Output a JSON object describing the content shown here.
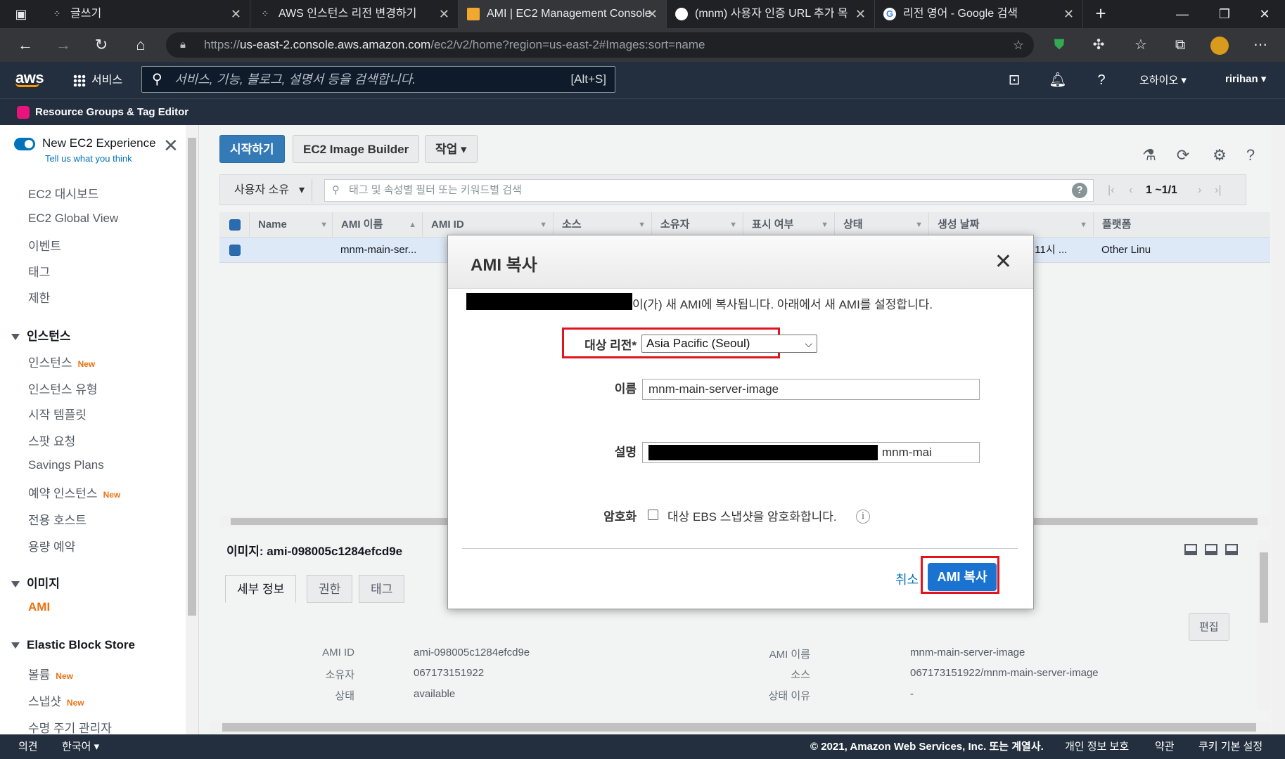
{
  "browser": {
    "tabs": [
      {
        "title": "글쓰기",
        "icon": "dots-favicon"
      },
      {
        "title": "AWS 인스턴스 리전 변경하기",
        "icon": "dots-favicon"
      },
      {
        "title": "AMI | EC2 Management Console",
        "icon": "aws-box-favicon",
        "active": true
      },
      {
        "title": "(mnm) 사용자 인증 URL 추가 목",
        "icon": "github-favicon"
      },
      {
        "title": "리전 영어 - Google 검색",
        "icon": "google-favicon"
      }
    ],
    "url_prefix": "https://",
    "url_host": "us-east-2.console.aws.amazon.com",
    "url_path": "/ec2/v2/home?region=us-east-2#Images:sort=name"
  },
  "aws_header": {
    "logo": "aws",
    "services": "서비스",
    "search_placeholder": "서비스, 기능, 블로그, 설명서 등을 검색합니다.",
    "search_shortcut": "[Alt+S]",
    "region": "오하이오 ▾",
    "user": "ririhan ▾",
    "resource_groups": "Resource Groups & Tag Editor"
  },
  "sidebar": {
    "new_experience": "New EC2 Experience",
    "tell_us": "Tell us what you think",
    "new_badge": "New",
    "items": [
      {
        "label": "EC2 대시보드"
      },
      {
        "label": "EC2 Global View"
      },
      {
        "label": "이벤트"
      },
      {
        "label": "태그"
      },
      {
        "label": "제한"
      }
    ],
    "section_instances": "인스턴스",
    "instances_items": [
      {
        "label": "인스턴스"
      },
      {
        "label": "인스턴스 유형"
      },
      {
        "label": "시작 템플릿"
      },
      {
        "label": "스팟 요청"
      },
      {
        "label": "Savings Plans"
      },
      {
        "label": "예약 인스턴스"
      },
      {
        "label": "전용 호스트"
      },
      {
        "label": "용량 예약"
      }
    ],
    "section_images": "이미지",
    "images_items": [
      {
        "label": "AMI"
      }
    ],
    "section_ebs": "Elastic Block Store",
    "ebs_items": [
      {
        "label": "볼륨"
      },
      {
        "label": "스냅샷"
      },
      {
        "label": "수명 주기 관리자"
      }
    ]
  },
  "toolbar": {
    "launch": "시작하기",
    "image_builder": "EC2 Image Builder",
    "actions": "작업 ▾"
  },
  "filter": {
    "owner": "사용자 소유",
    "placeholder": "태그 및 속성별 필터 또는 키워드별 검색",
    "pagination": "1 ~1/1"
  },
  "table": {
    "headers": [
      "Name",
      "AMI 이름",
      "AMI ID",
      "소스",
      "소유자",
      "표시 여부",
      "상태",
      "생성 날짜",
      "플랫폼"
    ],
    "row": {
      "name": "",
      "ami_name": "mnm-main-ser...",
      "creation_date": "2021년 11월 24일 오전 11시 ...",
      "platform": "Other Linu"
    }
  },
  "detail": {
    "title": "이미지: ami-098005c1284efcd9e",
    "tabs": [
      "세부 정보",
      "권한",
      "태그"
    ],
    "edit": "편집",
    "left": [
      {
        "key": "AMI ID",
        "value": "ami-098005c1284efcd9e"
      },
      {
        "key": "소유자",
        "value": "067173151922"
      },
      {
        "key": "상태",
        "value": "available"
      }
    ],
    "right": [
      {
        "key": "AMI 이름",
        "value": "mnm-main-server-image"
      },
      {
        "key": "소스",
        "value": "067173151922/mnm-main-server-image"
      },
      {
        "key": "상태 이유",
        "value": "-"
      }
    ]
  },
  "footer": {
    "feedback": "의견",
    "language": "한국어 ▾",
    "copyright": "© 2021, Amazon Web Services, Inc. 또는 계열사.",
    "privacy": "개인 정보 보호",
    "terms": "약관",
    "cookies": "쿠키 기본 설정"
  },
  "modal": {
    "title": "AMI 복사",
    "intro": "이(가) 새 AMI에 복사됩니다. 아래에서 새 AMI를 설정합니다.",
    "region_label": "대상 리전*",
    "region_value": "Asia Pacific (Seoul)",
    "name_label": "이름",
    "name_value": "mnm-main-server-image",
    "desc_label": "설명",
    "desc_value_tail": "mnm-mai",
    "encrypt_label": "암호화",
    "encrypt_checkbox": "대상 EBS 스냅샷을 암호화합니다.",
    "encrypt_checked": false,
    "cancel": "취소",
    "submit": "AMI 복사",
    "highlight_color": "#e1141e"
  }
}
